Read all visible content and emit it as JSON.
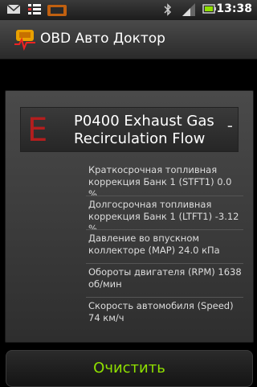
{
  "status_bar": {
    "time": "13:38",
    "icons": [
      "email-icon",
      "list-icon",
      "car-obd-icon",
      "bluetooth-icon",
      "signal-icon",
      "battery-icon"
    ]
  },
  "app": {
    "title": "OBD Авто Доктор",
    "logo_icon": "obd-logo-icon"
  },
  "dtc": {
    "letter": "E",
    "code_text": "P0400 Exhaust Gas Recirculation Flow",
    "collapse_symbol": "-"
  },
  "params": [
    "Краткосрочная топливная коррекция Банк 1 (STFT1) 0.0 %",
    "Долгосрочная топливная коррекция Банк 1 (LTFT1) -3.12 %",
    "Давление во впускном коллекторе (MAP) 24.0 кПа",
    "Обороты двигателя (RPM) 1638 об/мин",
    "Скорость автомобиля (Speed) 74 км/ч"
  ],
  "actions": {
    "clear_label": "Очистить"
  },
  "colors": {
    "accent_green": "#8fe000",
    "dtc_red": "#b31e1e"
  }
}
